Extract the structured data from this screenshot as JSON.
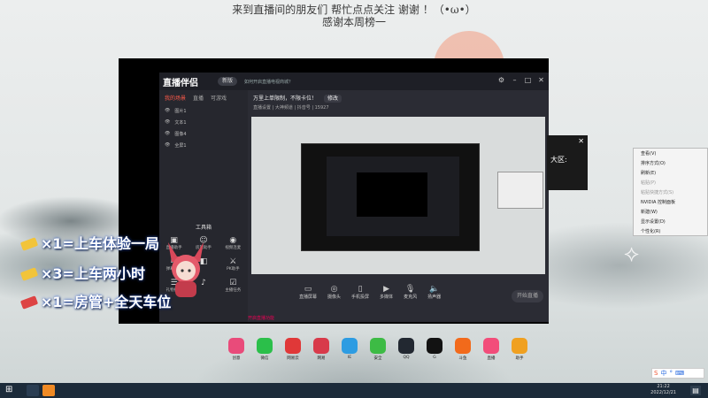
{
  "wallpaper": {
    "line1": "来到直播间的朋友们 帮忙点点关注 谢谢 ！（•ω•）",
    "line2": "感谢本周榜一"
  },
  "app": {
    "logo": "直播伴侣",
    "version_badge": "新版",
    "notice": "如何开启直播电视商城？",
    "left_tabs": [
      "我的场景",
      "直播",
      "可游戏"
    ],
    "scenes": [
      "图片1",
      "文本1",
      "图像4",
      "全屏1"
    ],
    "tools_title": "工具箱",
    "tools": [
      "直播助手",
      "房管助手",
      "视频连麦",
      "弹幕礼物",
      "",
      "PK助手",
      "礼物投票",
      "",
      "主播任务"
    ],
    "marquee": "万里上单限制，不限卡位！",
    "marquee_btn": "修改",
    "stream_info": "直播设置 | 大神频道 | 抖音号 | 15927",
    "controls": [
      "直播屏幕",
      "摄像头",
      "手机投屏",
      "多媒体",
      "麦克风",
      "扬声器"
    ],
    "go_live": "开始直播",
    "status_text": "开启直播功能"
  },
  "promo": {
    "line1": "×1=上车体验一局",
    "line2": "×3=上车两小时",
    "line3": "×1=房管+全天车位"
  },
  "dialog": {
    "text": "大区:"
  },
  "context_menu": {
    "items": [
      "查看(V)",
      "排序方式(O)",
      "刷新(E)",
      "粘贴(P)",
      "粘贴快捷方式(S)",
      "NVIDIA 控制面板",
      "新建(W)",
      "显示设置(D)",
      "个性化(R)"
    ]
  },
  "desktop_icons": [
    {
      "label": "创意",
      "color": "#e94b7a"
    },
    {
      "label": "微信",
      "color": "#2bbf4a"
    },
    {
      "label": "网易云",
      "color": "#e03838"
    },
    {
      "label": "网易",
      "color": "#d83a4a"
    },
    {
      "label": "IE",
      "color": "#2d9ce2"
    },
    {
      "label": "安全",
      "color": "#3dbb45"
    },
    {
      "label": "QQ",
      "color": "#222831"
    },
    {
      "label": "G",
      "color": "#121212"
    },
    {
      "label": "斗鱼",
      "color": "#f26a1b"
    },
    {
      "label": "直播",
      "color": "#f24d7a"
    },
    {
      "label": "助手",
      "color": "#f0a020"
    }
  ],
  "taskbar": {
    "time": "21:22",
    "date": "2022/12/21",
    "ime": "中"
  }
}
